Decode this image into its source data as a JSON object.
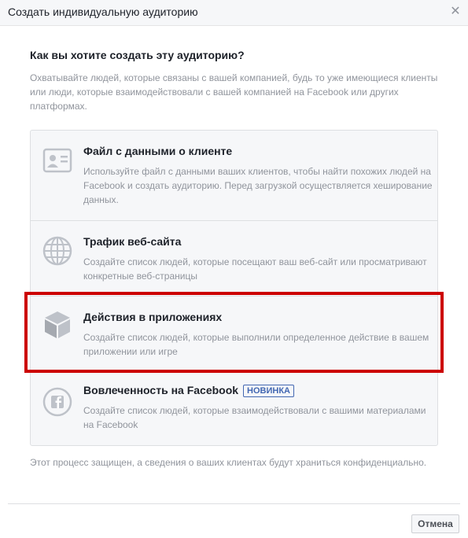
{
  "dialog": {
    "title": "Создать индивидуальную аудиторию",
    "close_icon": "close-icon"
  },
  "intro": {
    "question": "Как вы хотите создать эту аудиторию?",
    "description": "Охватывайте людей, которые связаны с вашей компанией, будь то уже имеющиеся клиенты или люди, которые взаимодействовали с вашей компанией на Facebook или других платформах."
  },
  "options": [
    {
      "icon": "contact-card-icon",
      "title": "Файл с данными о клиенте",
      "description": "Используйте файл с данными ваших клиентов, чтобы найти похожих людей на Facebook и создать аудиторию. Перед загрузкой осуществляется хеширование данных."
    },
    {
      "icon": "globe-icon",
      "title": "Трафик веб-сайта",
      "description": "Создайте список людей, которые посещают ваш веб-сайт или просматривают конкретные веб-страницы"
    },
    {
      "icon": "cube-icon",
      "title": "Действия в приложениях",
      "description": "Создайте список людей, которые выполнили определенное действие в вашем приложении или игре",
      "highlighted": true
    },
    {
      "icon": "facebook-icon",
      "title": "Вовлеченность на Facebook",
      "badge": "НОВИНКА",
      "description": "Создайте список людей, которые взаимодействовали с вашими материалами на Facebook"
    }
  ],
  "footnote": "Этот процесс защищен, а сведения о ваших клиентах будут храниться конфиденциально.",
  "footer": {
    "cancel_label": "Отмена"
  },
  "colors": {
    "highlight": "#cc0000",
    "accent": "#4267b2",
    "muted_text": "#90949c"
  }
}
